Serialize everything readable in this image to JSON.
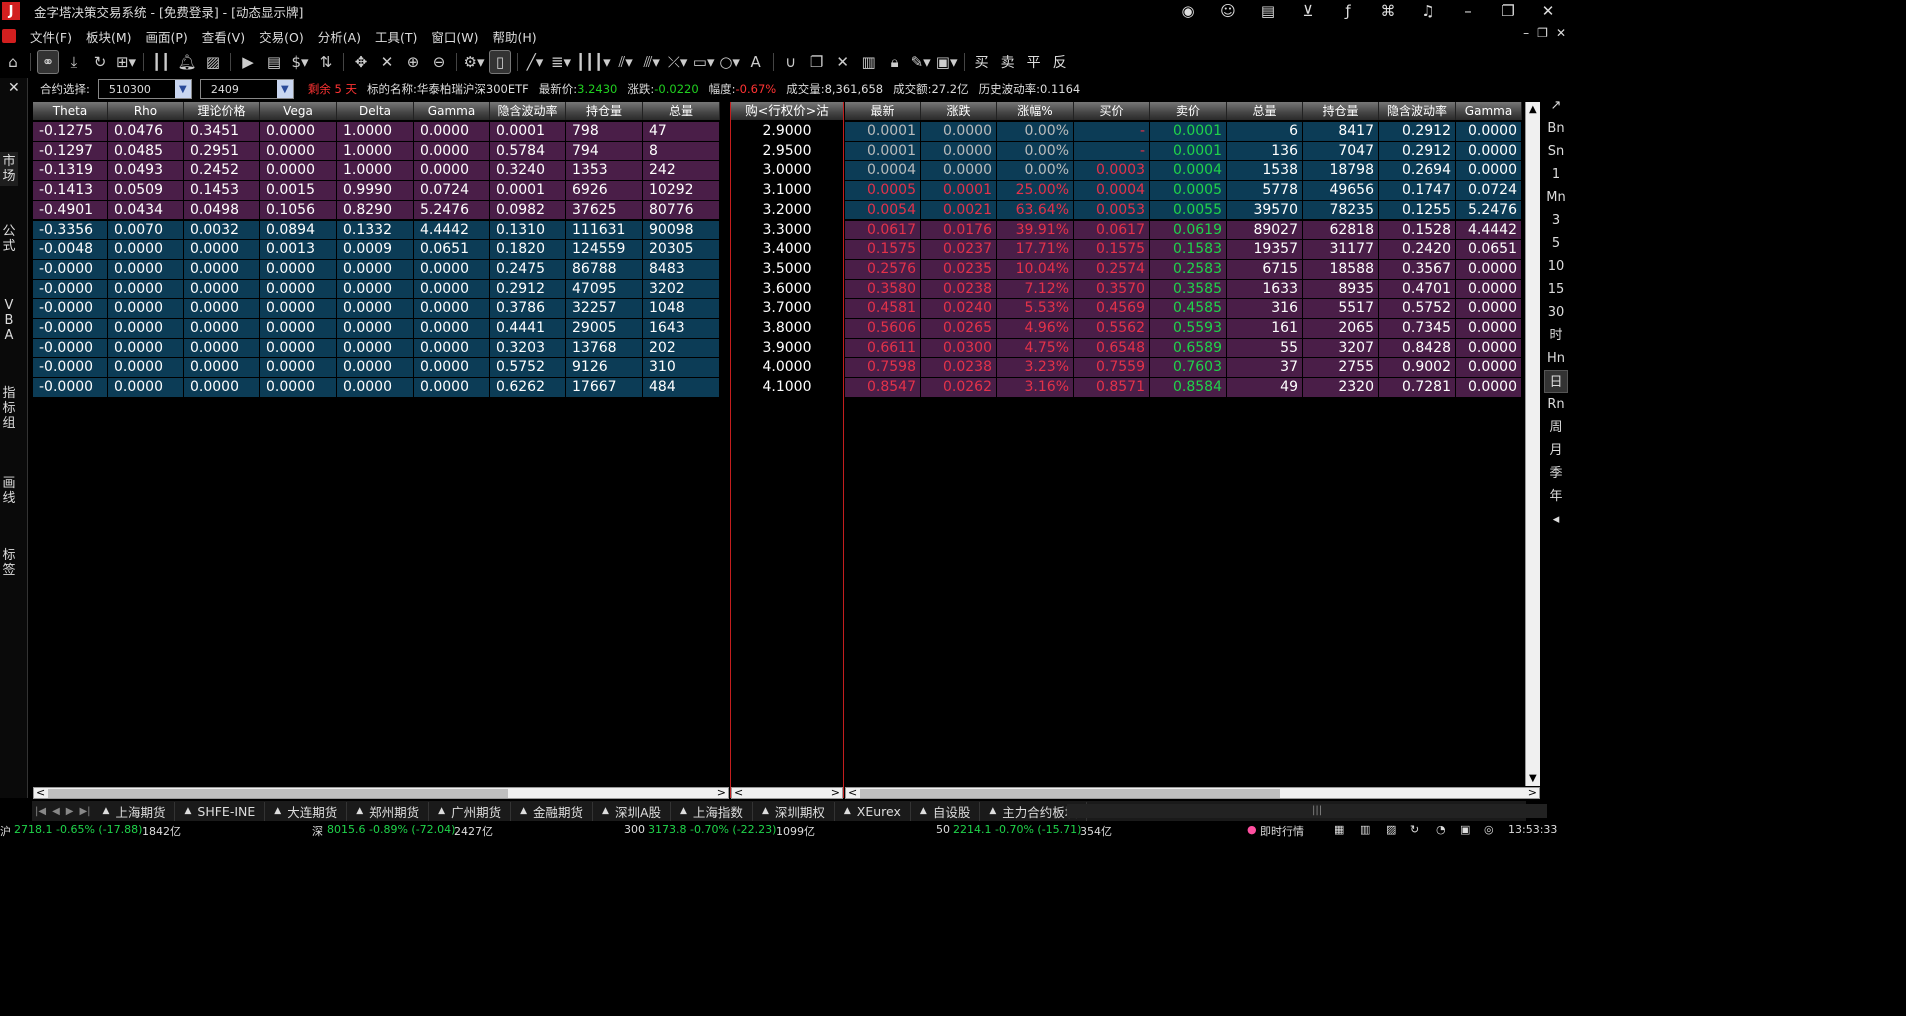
{
  "app": {
    "title": "金字塔决策交易系统 - [免费登录] - [动态显示牌]",
    "logo": "J"
  },
  "titlebar_icons": [
    "rss-icon",
    "user-icon",
    "document-icon",
    "cart-icon",
    "formula-icon",
    "python-icon",
    "headset-icon",
    "minimize-icon",
    "restore-icon",
    "close-icon"
  ],
  "menu": [
    "文件(F)",
    "板块(M)",
    "画面(P)",
    "查看(V)",
    "交易(O)",
    "分析(A)",
    "工具(T)",
    "窗口(W)",
    "帮助(H)"
  ],
  "toolbar_text": [
    "买",
    "卖",
    "平",
    "反"
  ],
  "leftbar": {
    "close": "✕",
    "tabs": [
      "市场",
      "公式",
      "VBA",
      "指标组",
      "画线",
      "标签"
    ]
  },
  "rightbar": [
    "Bn",
    "Sn",
    "1",
    "Mn",
    "3",
    "5",
    "10",
    "15",
    "30",
    "时",
    "Hn",
    "日",
    "Rn",
    "周",
    "月",
    "季",
    "年"
  ],
  "info": {
    "contract_label": "合约选择:",
    "underlying_code": "510300",
    "month": "2409",
    "remaining": "剩余 5 天",
    "name_label": "标的名称:",
    "name": "华泰柏瑞沪深300ETF",
    "last_label": "最新价:",
    "last": "3.2430",
    "chg_label": "涨跌:",
    "chg": "-0.0220",
    "amp_label": "幅度:",
    "amp": "-0.67%",
    "vol_label": "成交量:",
    "vol": "8,361,658",
    "amount_label": "成交额:",
    "amount": "27.2亿",
    "hv_label": "历史波动率:",
    "hv": "0.1164"
  },
  "left_headers": [
    "Theta",
    "Rho",
    "理论价格",
    "Vega",
    "Delta",
    "Gamma",
    "隐含波动率",
    "持仓量",
    "总量"
  ],
  "strike_header": "购<行权价>沽",
  "right_headers": [
    "最新",
    "涨跌",
    "涨幅%",
    "买价",
    "卖价",
    "总量",
    "持仓量",
    "隐含波动率",
    "Gamma"
  ],
  "rows": [
    {
      "call": [
        "-0.1275",
        "0.0476",
        "0.3451",
        "0.0000",
        "1.0000",
        "0.0000",
        "0.0001",
        "798",
        "47"
      ],
      "strike": "2.9000",
      "put": [
        "0.0001",
        "0.0000",
        "0.00%",
        "-",
        "0.0001",
        "6",
        "8417",
        "0.2912",
        "0.0000"
      ]
    },
    {
      "call": [
        "-0.1297",
        "0.0485",
        "0.2951",
        "0.0000",
        "1.0000",
        "0.0000",
        "0.5784",
        "794",
        "8"
      ],
      "strike": "2.9500",
      "put": [
        "0.0001",
        "0.0000",
        "0.00%",
        "-",
        "0.0001",
        "136",
        "7047",
        "0.2912",
        "0.0000"
      ]
    },
    {
      "call": [
        "-0.1319",
        "0.0493",
        "0.2452",
        "0.0000",
        "1.0000",
        "0.0000",
        "0.3240",
        "1353",
        "242"
      ],
      "strike": "3.0000",
      "put": [
        "0.0004",
        "0.0000",
        "0.00%",
        "0.0003",
        "0.0004",
        "1538",
        "18798",
        "0.2694",
        "0.0000"
      ]
    },
    {
      "call": [
        "-0.1413",
        "0.0509",
        "0.1453",
        "0.0015",
        "0.9990",
        "0.0724",
        "0.0001",
        "6926",
        "10292"
      ],
      "strike": "3.1000",
      "put": [
        "0.0005",
        "0.0001",
        "25.00%",
        "0.0004",
        "0.0005",
        "5778",
        "49656",
        "0.1747",
        "0.0724"
      ]
    },
    {
      "call": [
        "-0.4901",
        "0.0434",
        "0.0498",
        "0.1056",
        "0.8290",
        "5.2476",
        "0.0982",
        "37625",
        "80776"
      ],
      "strike": "3.2000",
      "put": [
        "0.0054",
        "0.0021",
        "63.64%",
        "0.0053",
        "0.0055",
        "39570",
        "78235",
        "0.1255",
        "5.2476"
      ]
    },
    {
      "call": [
        "-0.3356",
        "0.0070",
        "0.0032",
        "0.0894",
        "0.1332",
        "4.4442",
        "0.1310",
        "111631",
        "90098"
      ],
      "strike": "3.3000",
      "put": [
        "0.0617",
        "0.0176",
        "39.91%",
        "0.0617",
        "0.0619",
        "89027",
        "62818",
        "0.1528",
        "4.4442"
      ]
    },
    {
      "call": [
        "-0.0048",
        "0.0000",
        "0.0000",
        "0.0013",
        "0.0009",
        "0.0651",
        "0.1820",
        "124559",
        "20305"
      ],
      "strike": "3.4000",
      "put": [
        "0.1575",
        "0.0237",
        "17.71%",
        "0.1575",
        "0.1583",
        "19357",
        "31177",
        "0.2420",
        "0.0651"
      ]
    },
    {
      "call": [
        "-0.0000",
        "0.0000",
        "0.0000",
        "0.0000",
        "0.0000",
        "0.0000",
        "0.2475",
        "86788",
        "8483"
      ],
      "strike": "3.5000",
      "put": [
        "0.2576",
        "0.0235",
        "10.04%",
        "0.2574",
        "0.2583",
        "6715",
        "18588",
        "0.3567",
        "0.0000"
      ]
    },
    {
      "call": [
        "-0.0000",
        "0.0000",
        "0.0000",
        "0.0000",
        "0.0000",
        "0.0000",
        "0.2912",
        "47095",
        "3202"
      ],
      "strike": "3.6000",
      "put": [
        "0.3580",
        "0.0238",
        "7.12%",
        "0.3570",
        "0.3585",
        "1633",
        "8935",
        "0.4701",
        "0.0000"
      ]
    },
    {
      "call": [
        "-0.0000",
        "0.0000",
        "0.0000",
        "0.0000",
        "0.0000",
        "0.0000",
        "0.3786",
        "32257",
        "1048"
      ],
      "strike": "3.7000",
      "put": [
        "0.4581",
        "0.0240",
        "5.53%",
        "0.4569",
        "0.4585",
        "316",
        "5517",
        "0.5752",
        "0.0000"
      ]
    },
    {
      "call": [
        "-0.0000",
        "0.0000",
        "0.0000",
        "0.0000",
        "0.0000",
        "0.0000",
        "0.4441",
        "29005",
        "1643"
      ],
      "strike": "3.8000",
      "put": [
        "0.5606",
        "0.0265",
        "4.96%",
        "0.5562",
        "0.5593",
        "161",
        "2065",
        "0.7345",
        "0.0000"
      ]
    },
    {
      "call": [
        "-0.0000",
        "0.0000",
        "0.0000",
        "0.0000",
        "0.0000",
        "0.0000",
        "0.3203",
        "13768",
        "202"
      ],
      "strike": "3.9000",
      "put": [
        "0.6611",
        "0.0300",
        "4.75%",
        "0.6548",
        "0.6589",
        "55",
        "3207",
        "0.8428",
        "0.0000"
      ]
    },
    {
      "call": [
        "-0.0000",
        "0.0000",
        "0.0000",
        "0.0000",
        "0.0000",
        "0.0000",
        "0.5752",
        "9126",
        "310"
      ],
      "strike": "4.0000",
      "put": [
        "0.7598",
        "0.0238",
        "3.23%",
        "0.7559",
        "0.7603",
        "37",
        "2755",
        "0.9002",
        "0.0000"
      ]
    },
    {
      "call": [
        "-0.0000",
        "0.0000",
        "0.0000",
        "0.0000",
        "0.0000",
        "0.0000",
        "0.6262",
        "17667",
        "484"
      ],
      "strike": "4.1000",
      "put": [
        "0.8547",
        "0.0262",
        "3.16%",
        "0.8571",
        "0.8584",
        "49",
        "2320",
        "0.7281",
        "0.0000"
      ]
    }
  ],
  "row_colors": {
    "purple": "#4a1e48",
    "blue": "#0c3c56",
    "up": "#e3324a",
    "down": "#1fd34a"
  },
  "tabs": [
    "上海期货",
    "SHFE-INE",
    "大连期货",
    "郑州期货",
    "广州期货",
    "金融期货",
    "深圳A股",
    "上海指数",
    "深圳期权",
    "XEurex",
    "自设股",
    "主力合约板块"
  ],
  "status": {
    "sh_label": "沪",
    "sh": "2718.1 -0.65% (-17.88)",
    "sh_amt": "1842亿",
    "sz_label": "深",
    "sz": "8015.6 -0.89% (-72.04)",
    "sz_amt": "2427亿",
    "i300_label": "300",
    "i300": "3173.8 -0.70% (-22.23)",
    "i300_amt": "1099亿",
    "i50_label": "50",
    "i50": "2214.1 -0.70% (-15.71)",
    "i50_amt": "354亿",
    "realtime": "即时行情",
    "time": "13:53:33"
  }
}
